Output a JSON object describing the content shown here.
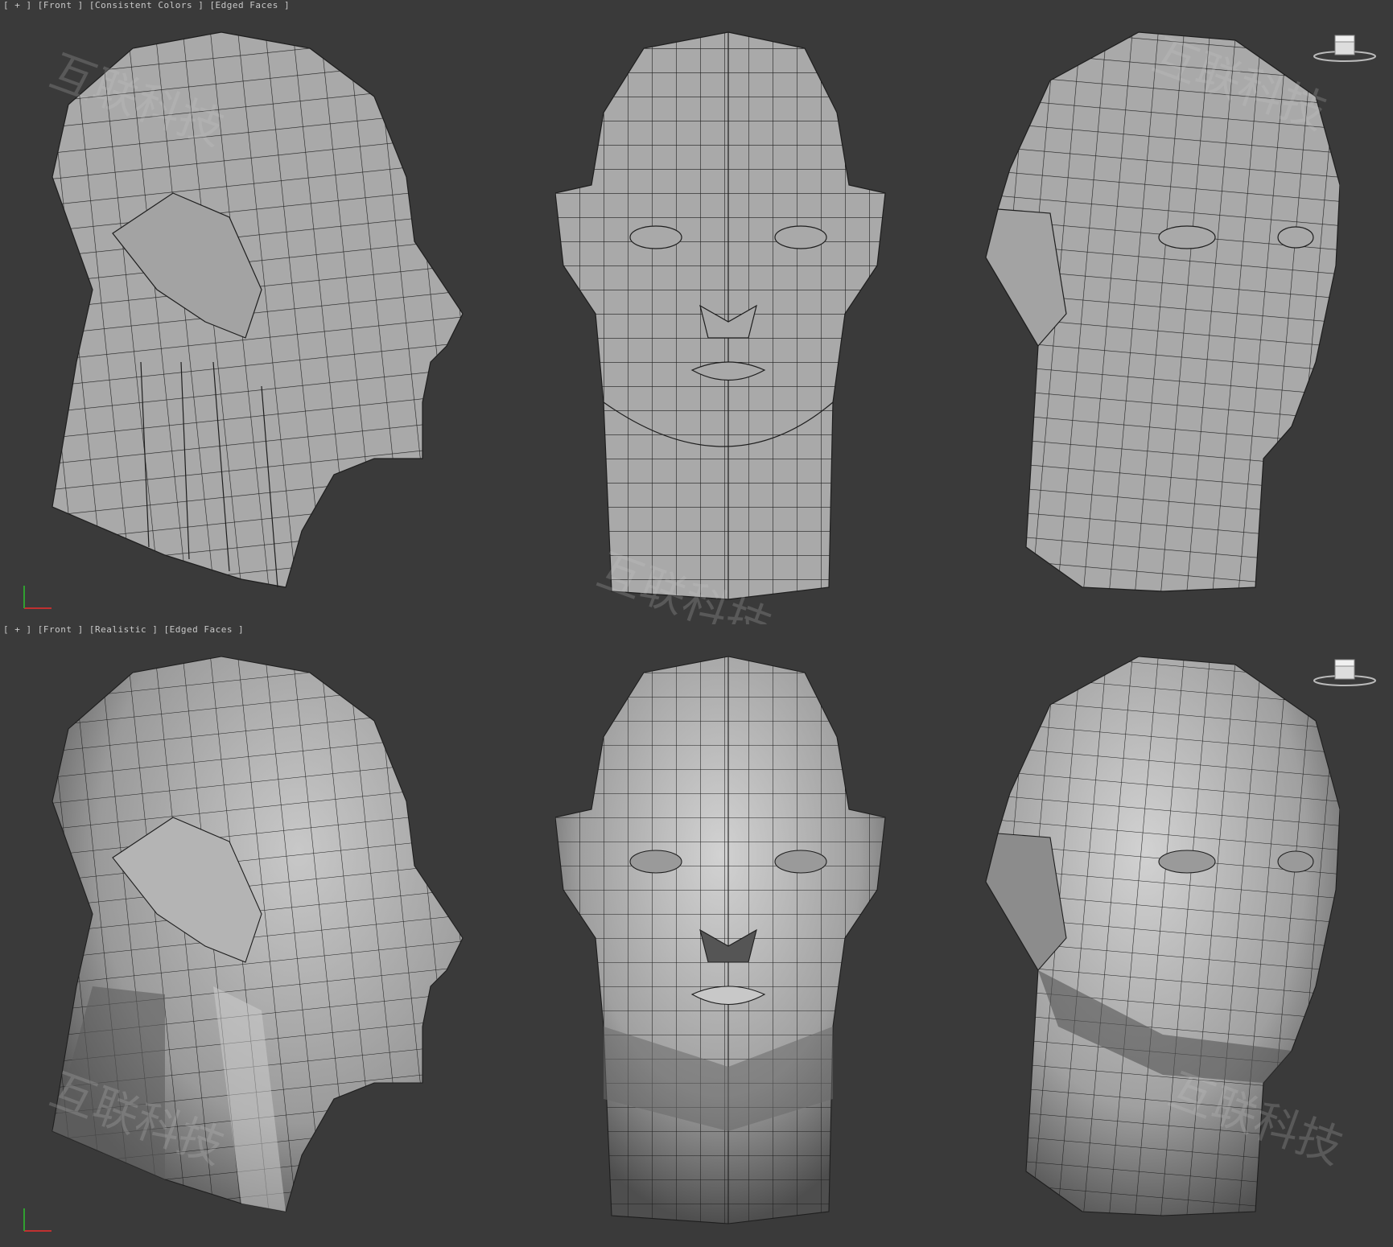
{
  "viewports": {
    "top": {
      "label_parts": [
        "[ + ]",
        "[Front ]",
        "[Consistent Colors ]",
        "[Edged Faces ]"
      ],
      "shading": "Consistent Colors"
    },
    "bottom": {
      "label_parts": [
        "[ + ]",
        "[Front ]",
        "[Realistic ]",
        "[Edged Faces ]"
      ],
      "shading": "Realistic"
    }
  },
  "viewcube": {
    "icon": "viewcube-icon"
  },
  "watermark": "互联科技",
  "colors": {
    "background": "#3a3a3a",
    "mesh_fill": "#a9a9a9",
    "mesh_wire": "#1e1e1e",
    "label_text": "#c8c8c8"
  },
  "heads": [
    "side-view",
    "front-view",
    "three-quarter-view"
  ]
}
